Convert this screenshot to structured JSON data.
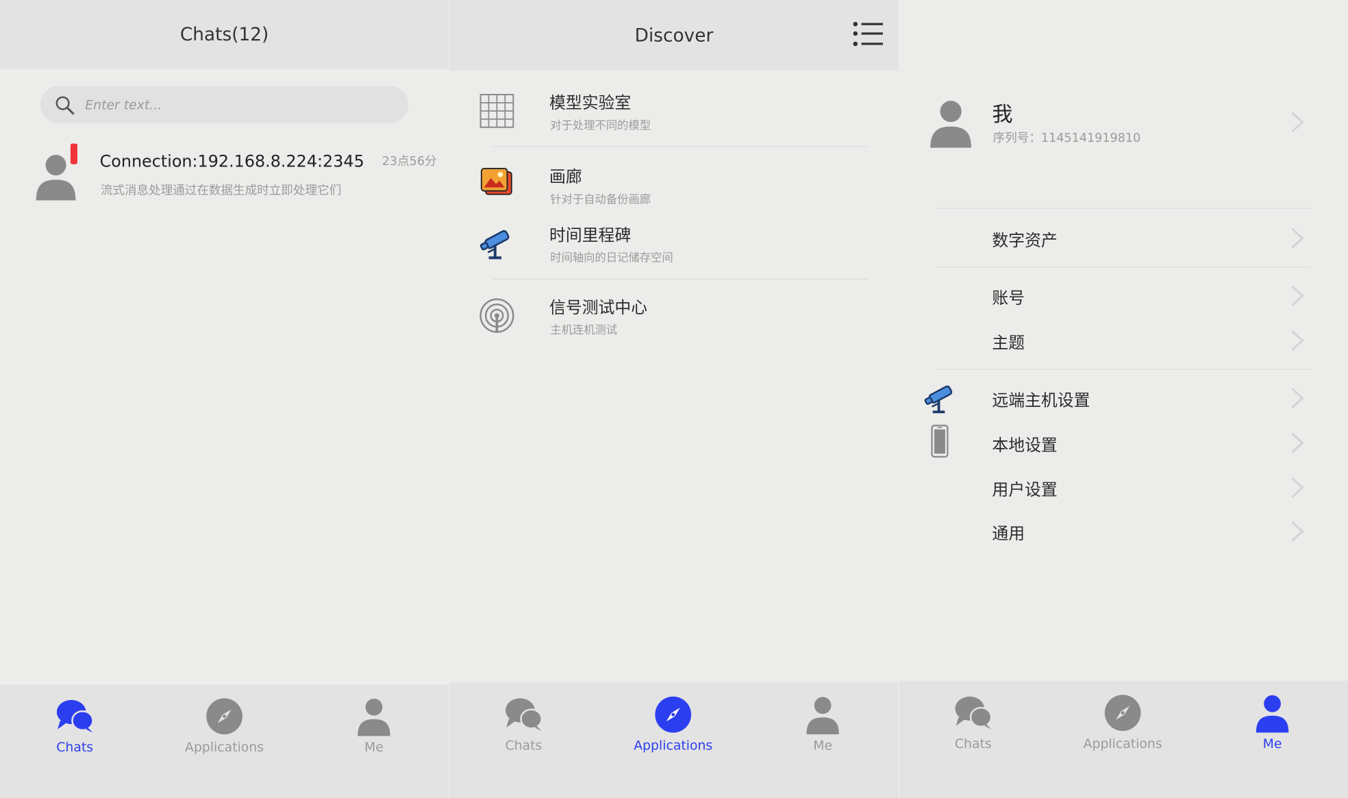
{
  "colors": {
    "accent": "#2b3ef0",
    "inactive": "#9a9a9a",
    "badge": "#f2333b",
    "header": "#e3e3e3",
    "background": "#ececea"
  },
  "chats_panel": {
    "title": "Chats(12)",
    "search": {
      "placeholder": "Enter text..."
    },
    "conversations": [
      {
        "name": "Connection:192.168.8.224:2345",
        "preview": "流式消息处理通过在数据生成时立即处理它们",
        "time": "23点56分",
        "unread_indicator": true
      }
    ]
  },
  "discover_panel": {
    "title": "Discover",
    "menu_icon": "list-menu-icon",
    "items": [
      {
        "icon": "grid-icon",
        "title": "模型实验室",
        "subtitle": "对于处理不同的模型"
      },
      {
        "icon": "gallery-photo-icon",
        "title": "画廊",
        "subtitle": "针对于自动备份画廊"
      },
      {
        "icon": "telescope-icon",
        "title": "时间里程碑",
        "subtitle": "时间轴向的日记储存空间"
      },
      {
        "icon": "signal-icon",
        "title": "信号测试中心",
        "subtitle": "主机连机测试"
      }
    ]
  },
  "me_panel": {
    "profile": {
      "name": "我",
      "serial": "序列号：1145141919810"
    },
    "items": [
      {
        "label": "数字资产"
      },
      {
        "label": "账号"
      },
      {
        "label": "主题"
      },
      {
        "label": "远端主机设置",
        "icon": "telescope-icon"
      },
      {
        "label": "本地设置",
        "icon": "phone-icon"
      },
      {
        "label": "用户设置"
      },
      {
        "label": "通用"
      }
    ]
  },
  "tabbar": {
    "labels": [
      "Chats",
      "Applications",
      "Me"
    ],
    "icons": [
      "chat-bubbles-icon",
      "compass-icon",
      "person-icon"
    ]
  },
  "active_tabs": {
    "chats_panel": "Chats",
    "discover_panel": "Applications",
    "me_panel": "Me"
  }
}
